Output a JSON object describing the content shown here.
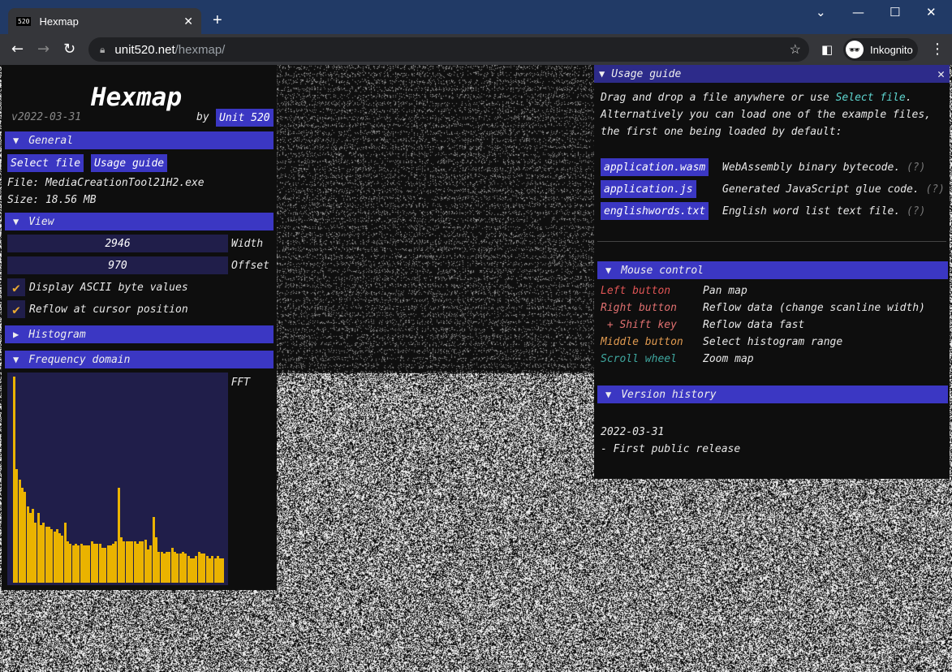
{
  "browser": {
    "tab_title": "Hexmap",
    "favicon": "520",
    "url_host": "unit520.net",
    "url_path": "/hexmap/",
    "profile": "Inkognito"
  },
  "left": {
    "title": "Hexmap",
    "version": "v2022-03-31",
    "by": "by",
    "author_button": "Unit 520",
    "general_header": "General",
    "select_file": "Select file",
    "usage_guide": "Usage guide",
    "file": "File: MediaCreationTool21H2.exe",
    "size": "Size: 18.56 MB",
    "view_header": "View",
    "width_value": "2946",
    "width_label": "Width",
    "offset_value": "970",
    "offset_label": "Offset",
    "display_ascii": "Display ASCII byte values",
    "display_ascii_checked": true,
    "reflow": "Reflow at cursor position",
    "reflow_checked": true,
    "histogram_header": "Histogram",
    "frequency_header": "Frequency domain",
    "fft_label": "FFT"
  },
  "chart_data": {
    "type": "bar",
    "ylim": [
      0,
      100
    ],
    "values": [
      100,
      55,
      50,
      46,
      44,
      37,
      34,
      36,
      29,
      34,
      28,
      29,
      27,
      27,
      26,
      25,
      26,
      24,
      23,
      29,
      20,
      19,
      18,
      19,
      18,
      19,
      18,
      18,
      18,
      20,
      19,
      19,
      19,
      17,
      17,
      18,
      18,
      19,
      20,
      46,
      22,
      20,
      20,
      20,
      20,
      20,
      19,
      20,
      20,
      21,
      16,
      18,
      32,
      22,
      15,
      15,
      14,
      15,
      15,
      17,
      15,
      14,
      14,
      15,
      14,
      13,
      12,
      12,
      13,
      15,
      14,
      14,
      13,
      12,
      13,
      12,
      13,
      12,
      12
    ],
    "color": "#eab300"
  },
  "right": {
    "title": "Usage guide",
    "intro_a": "Drag and drop a file anywhere or use ",
    "intro_link": "Select file",
    "intro_b": ".",
    "intro_2": "Alternatively you can load one of the example files,",
    "intro_3": "the first one being loaded by default:",
    "examples": [
      {
        "name": "application.wasm",
        "desc": "WebAssembly binary bytecode.",
        "help": "(?)"
      },
      {
        "name": "application.js",
        "desc": "Generated JavaScript glue code.",
        "help": "(?)"
      },
      {
        "name": "englishwords.txt",
        "desc": "English word list text file.",
        "help": "(?)"
      }
    ],
    "mouse_header": "Mouse control",
    "mouse": [
      {
        "key": "Left button",
        "action": "Pan map",
        "color": "#e05555"
      },
      {
        "key": "Right button",
        "action": "Reflow data (change scanline width)",
        "color": "#e07070"
      },
      {
        "key": " + Shift key",
        "action": "Reflow data fast",
        "color": "#e07070"
      },
      {
        "key": "Middle button",
        "action": "Select histogram range",
        "color": "#e09a50"
      },
      {
        "key": "Scroll wheel",
        "action": "Zoom map",
        "color": "#3fa8a0"
      }
    ],
    "version_header": "Version history",
    "version_date": "2022-03-31",
    "version_note": "- First public release"
  }
}
